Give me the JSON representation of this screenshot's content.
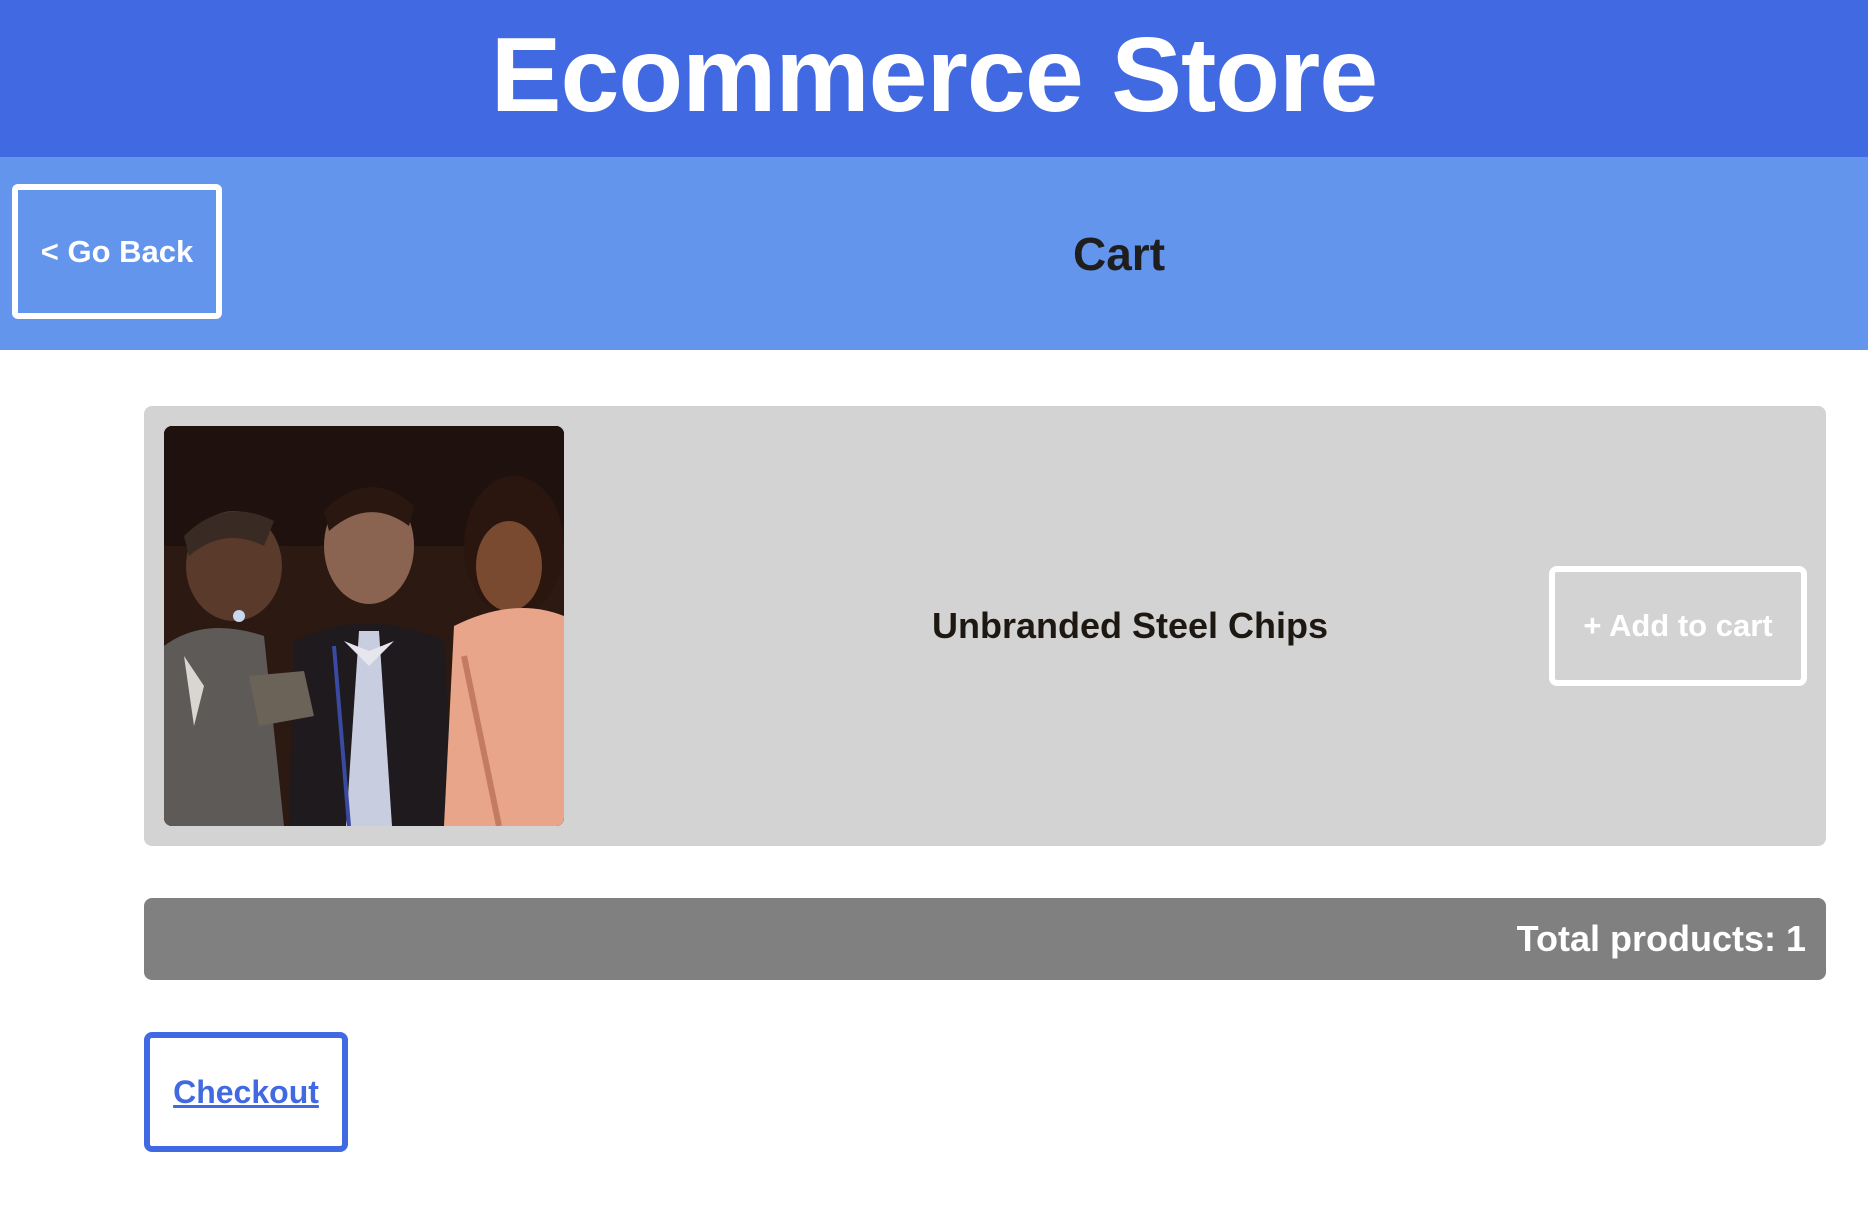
{
  "header": {
    "store_title": "Ecommerce Store",
    "brand_color": "#4169e1"
  },
  "subheader": {
    "back_label": "< Go Back",
    "page_title": "Cart",
    "bar_color": "#6495ed"
  },
  "cart": {
    "items": [
      {
        "name": "Unbranded Steel Chips",
        "image": "product-photo",
        "add_label": "+ Add to cart"
      }
    ],
    "total_label": "Total products: 1"
  },
  "actions": {
    "checkout_label": "Checkout"
  }
}
